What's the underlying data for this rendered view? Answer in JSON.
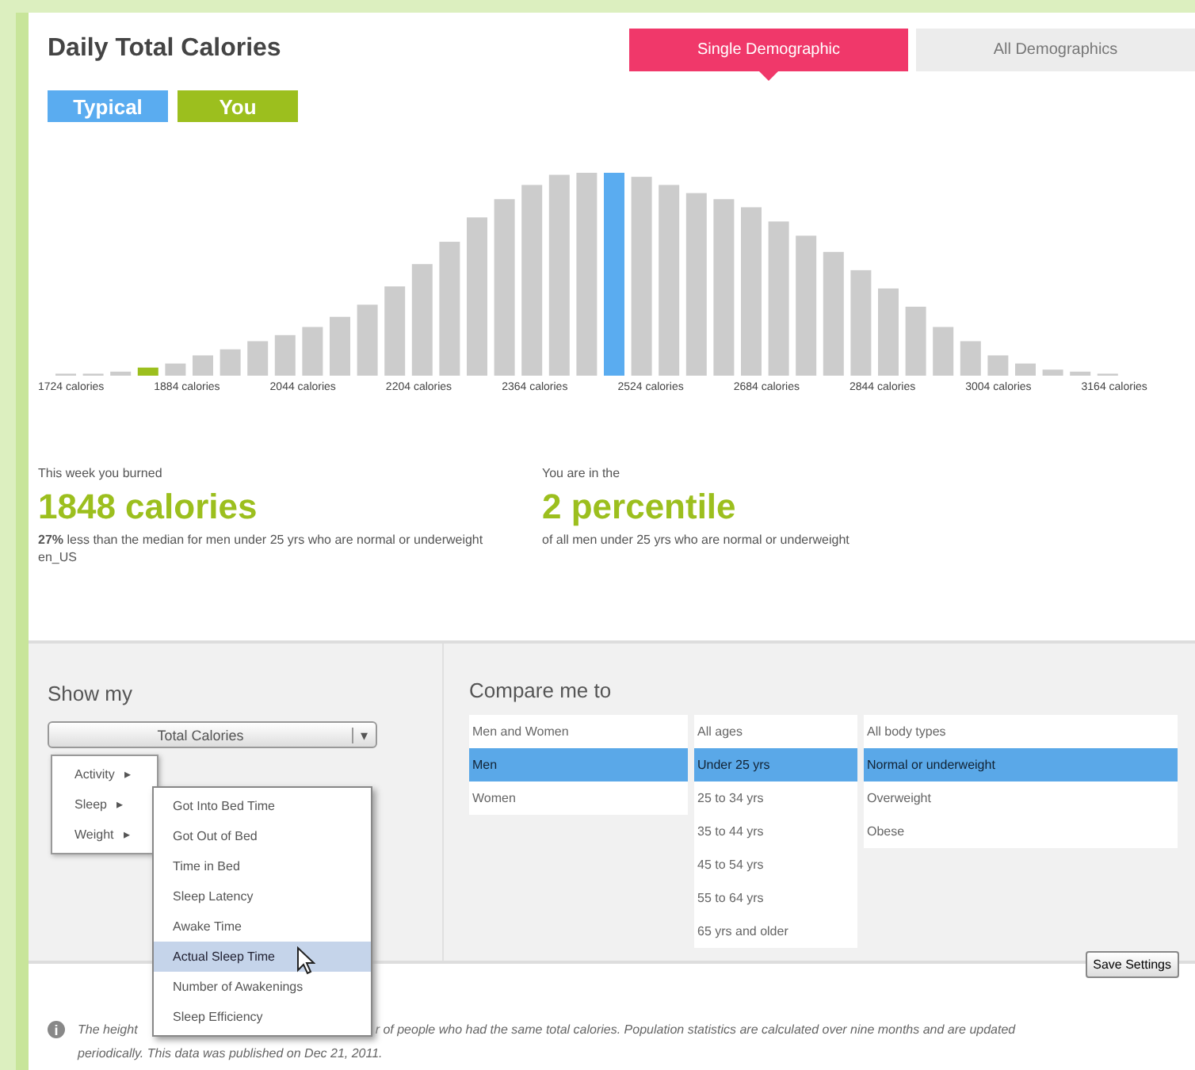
{
  "title": "Daily Total Calories",
  "tabs": [
    {
      "label": "Single Demographic",
      "selected": true
    },
    {
      "label": "All Demographics",
      "selected": false
    }
  ],
  "legend": [
    {
      "label": "Typical",
      "color": "#5aacf0"
    },
    {
      "label": "You",
      "color": "#9cbf1e"
    }
  ],
  "bars": [
    {
      "kind": "other"
    },
    {
      "kind": "other"
    },
    {
      "kind": "other"
    },
    {
      "kind": "you"
    },
    {
      "kind": "other"
    },
    {
      "kind": "other"
    },
    {
      "kind": "other"
    },
    {
      "kind": "other"
    },
    {
      "kind": "other"
    },
    {
      "kind": "other"
    },
    {
      "kind": "other"
    },
    {
      "kind": "other"
    },
    {
      "kind": "other"
    },
    {
      "kind": "other"
    },
    {
      "kind": "other"
    },
    {
      "kind": "other"
    },
    {
      "kind": "other"
    },
    {
      "kind": "other"
    },
    {
      "kind": "other"
    },
    {
      "kind": "other"
    },
    {
      "kind": "typical"
    },
    {
      "kind": "other"
    },
    {
      "kind": "other"
    },
    {
      "kind": "other"
    },
    {
      "kind": "other"
    },
    {
      "kind": "other"
    },
    {
      "kind": "other"
    },
    {
      "kind": "other"
    },
    {
      "kind": "other"
    },
    {
      "kind": "other"
    },
    {
      "kind": "other"
    },
    {
      "kind": "other"
    },
    {
      "kind": "other"
    },
    {
      "kind": "other"
    },
    {
      "kind": "other"
    },
    {
      "kind": "other"
    },
    {
      "kind": "other"
    },
    {
      "kind": "other"
    },
    {
      "kind": "other"
    }
  ],
  "axis_labels": [
    "1724 calories",
    "1884 calories",
    "2044 calories",
    "2204 calories",
    "2364 calories",
    "2524 calories",
    "2684 calories",
    "2844 calories",
    "3004 calories",
    "3164 calories"
  ],
  "burned": {
    "caption": "This week you burned",
    "value": "1848 calories",
    "note": "**27%** less than the median for men under 25 yrs who are normal or underweight",
    "locale": "en_US"
  },
  "percentile": {
    "caption": "You are in the",
    "value": "2 percentile",
    "note": "of all men under 25 yrs who are normal or underweight"
  },
  "show_my": {
    "heading": "Show my",
    "dropdown": "Total Calories",
    "dropdown_arrow": "▾",
    "menu": [
      {
        "label": "Activity",
        "arrow": "▸"
      },
      {
        "label": "Sleep",
        "arrow": "▸"
      },
      {
        "label": "Weight",
        "arrow": "▸"
      }
    ],
    "submenu": [
      {
        "label": "Got Into Bed Time",
        "selected": false
      },
      {
        "label": "Got Out of Bed",
        "selected": false
      },
      {
        "label": "Time in Bed",
        "selected": false
      },
      {
        "label": "Sleep Latency",
        "selected": false
      },
      {
        "label": "Awake Time",
        "selected": false
      },
      {
        "label": "Actual Sleep Time",
        "selected": true
      },
      {
        "label": "Number of Awakenings",
        "selected": false
      },
      {
        "label": "Sleep Efficiency",
        "selected": false
      }
    ]
  },
  "compare": {
    "heading": "Compare me to",
    "columns": [
      [
        {
          "label": "Men and Women",
          "selected": false
        },
        {
          "label": "Men",
          "selected": true
        },
        {
          "label": "Women",
          "selected": false
        }
      ],
      [
        {
          "label": "All ages",
          "selected": false
        },
        {
          "label": "Under 25 yrs",
          "selected": true
        },
        {
          "label": "25 to 34 yrs",
          "selected": false
        },
        {
          "label": "35 to 44 yrs",
          "selected": false
        },
        {
          "label": "45 to 54 yrs",
          "selected": false
        },
        {
          "label": "55 to 64 yrs",
          "selected": false
        },
        {
          "label": "65 yrs and older",
          "selected": false
        }
      ],
      [
        {
          "label": "All body types",
          "selected": false
        },
        {
          "label": "Normal or underweight",
          "selected": true
        },
        {
          "label": "Overweight",
          "selected": false
        },
        {
          "label": "Obese",
          "selected": false
        }
      ]
    ],
    "button": "Save Settings"
  },
  "footer": {
    "icon": "i",
    "line_start": "The height",
    "line_rest": "r of people who had the same total calories. Population statistics are calculated over nine months and are updated",
    "line_2": "periodically. This data was published on Dec 21, 2011."
  }
}
